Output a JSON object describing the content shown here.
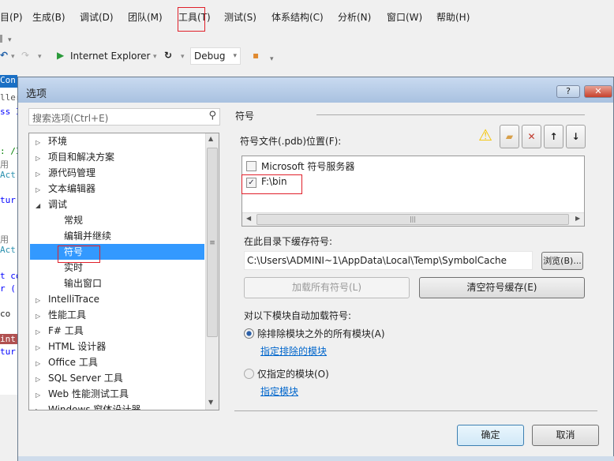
{
  "menu": [
    "目(P)",
    "生成(B)",
    "调试(D)",
    "团队(M)",
    "工具(T)",
    "测试(S)",
    "体系结构(C)",
    "分析(N)",
    "窗口(W)",
    "帮助(H)"
  ],
  "toolbar": {
    "browser": "Internet Explorer",
    "config": "Debug"
  },
  "editor": {
    "tab": "Con",
    "lines": [
      "llers",
      "ss I",
      ": /I",
      "用",
      "Act",
      "tur",
      "用",
      "Act",
      "t co",
      "r (:",
      "co",
      "int",
      "tur"
    ]
  },
  "dialog": {
    "title": "选项",
    "help": "?",
    "close": "✕",
    "search_placeholder": "搜索选项(Ctrl+E)",
    "tree": [
      {
        "label": "环境",
        "level": 0,
        "expanded": false
      },
      {
        "label": "项目和解决方案",
        "level": 0,
        "expanded": false
      },
      {
        "label": "源代码管理",
        "level": 0,
        "expanded": false
      },
      {
        "label": "文本编辑器",
        "level": 0,
        "expanded": false
      },
      {
        "label": "调试",
        "level": 0,
        "expanded": true
      },
      {
        "label": "常规",
        "level": 1
      },
      {
        "label": "编辑并继续",
        "level": 1
      },
      {
        "label": "符号",
        "level": 1,
        "selected": true
      },
      {
        "label": "实时",
        "level": 1
      },
      {
        "label": "输出窗口",
        "level": 1
      },
      {
        "label": "IntelliTrace",
        "level": 0,
        "expanded": false
      },
      {
        "label": "性能工具",
        "level": 0,
        "expanded": false
      },
      {
        "label": "F# 工具",
        "level": 0,
        "expanded": false
      },
      {
        "label": "HTML 设计器",
        "level": 0,
        "expanded": false
      },
      {
        "label": "Office 工具",
        "level": 0,
        "expanded": false
      },
      {
        "label": "SQL Server 工具",
        "level": 0,
        "expanded": false
      },
      {
        "label": "Web 性能测试工具",
        "level": 0,
        "expanded": false
      },
      {
        "label": "Windows 窗体设计器",
        "level": 0,
        "expanded": false
      }
    ],
    "section_title": "符号",
    "pdb_label": "符号文件(.pdb)位置(F):",
    "locations": [
      {
        "label": "Microsoft 符号服务器",
        "checked": false
      },
      {
        "label": "F:\\bin",
        "checked": true
      }
    ],
    "cache_label": "在此目录下缓存符号:",
    "cache_path": "C:\\Users\\ADMINI~1\\AppData\\Local\\Temp\\SymbolCache",
    "browse": "浏览(B)...",
    "load_all": "加载所有符号(L)",
    "clear_cache": "清空符号缓存(E)",
    "auto_label": "对以下模块自动加载符号:",
    "radio_all": "除排除模块之外的所有模块(A)",
    "link_exclude": "指定排除的模块",
    "radio_only": "仅指定的模块(O)",
    "link_only": "指定模块",
    "ok": "确定",
    "cancel": "取消"
  },
  "colors": {
    "selection": "#3399ff",
    "highlight_box": "#e0202a",
    "link": "#0066cc"
  }
}
